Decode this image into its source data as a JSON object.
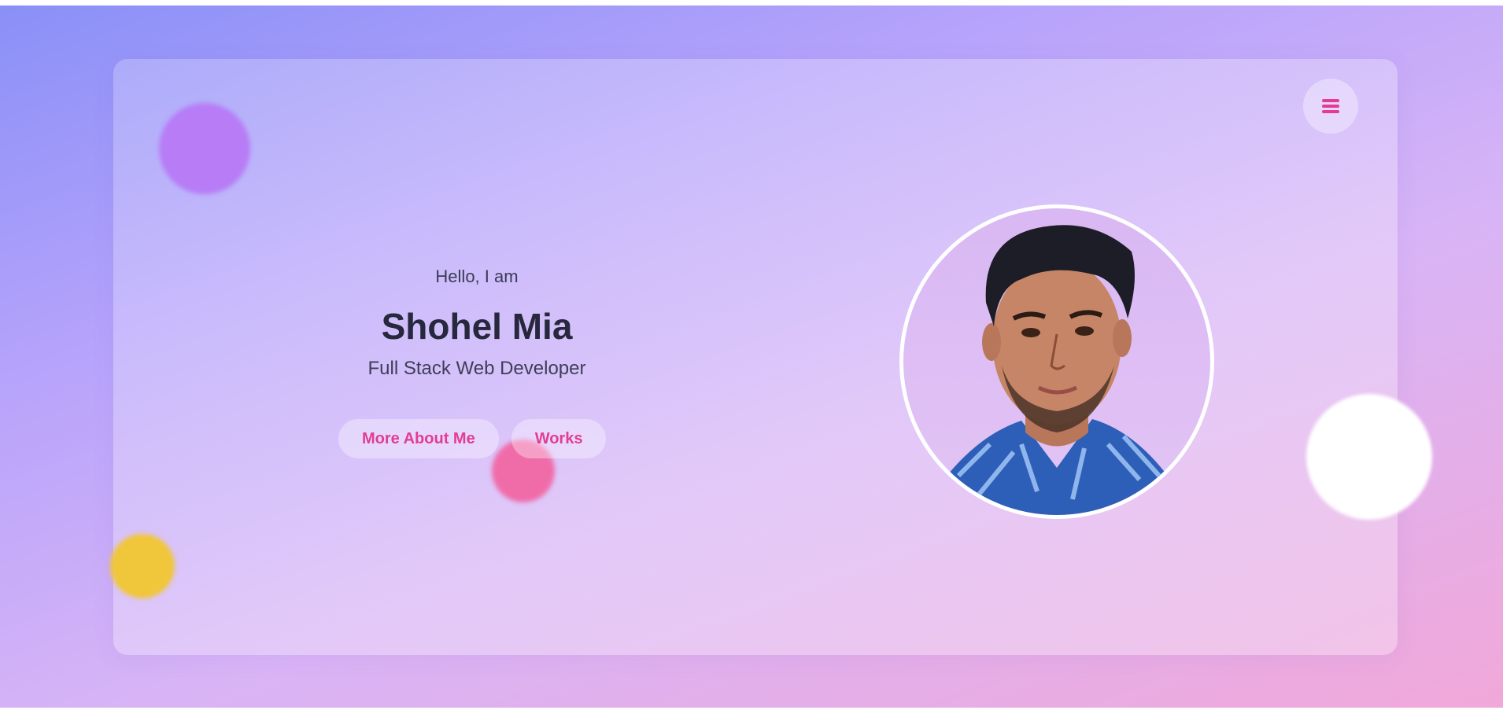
{
  "hero": {
    "greeting": "Hello, I am",
    "name": "Shohel Mia",
    "role": "Full Stack Web Developer"
  },
  "buttons": {
    "more_about_me": "More About Me",
    "works": "Works"
  },
  "icons": {
    "menu": "hamburger-menu-icon"
  },
  "colors": {
    "accent": "#e23d93",
    "text_dark": "#27273d",
    "blob_purple": "#b77cf6",
    "blob_pink": "#f06ca9",
    "blob_yellow": "#f0c63a"
  }
}
